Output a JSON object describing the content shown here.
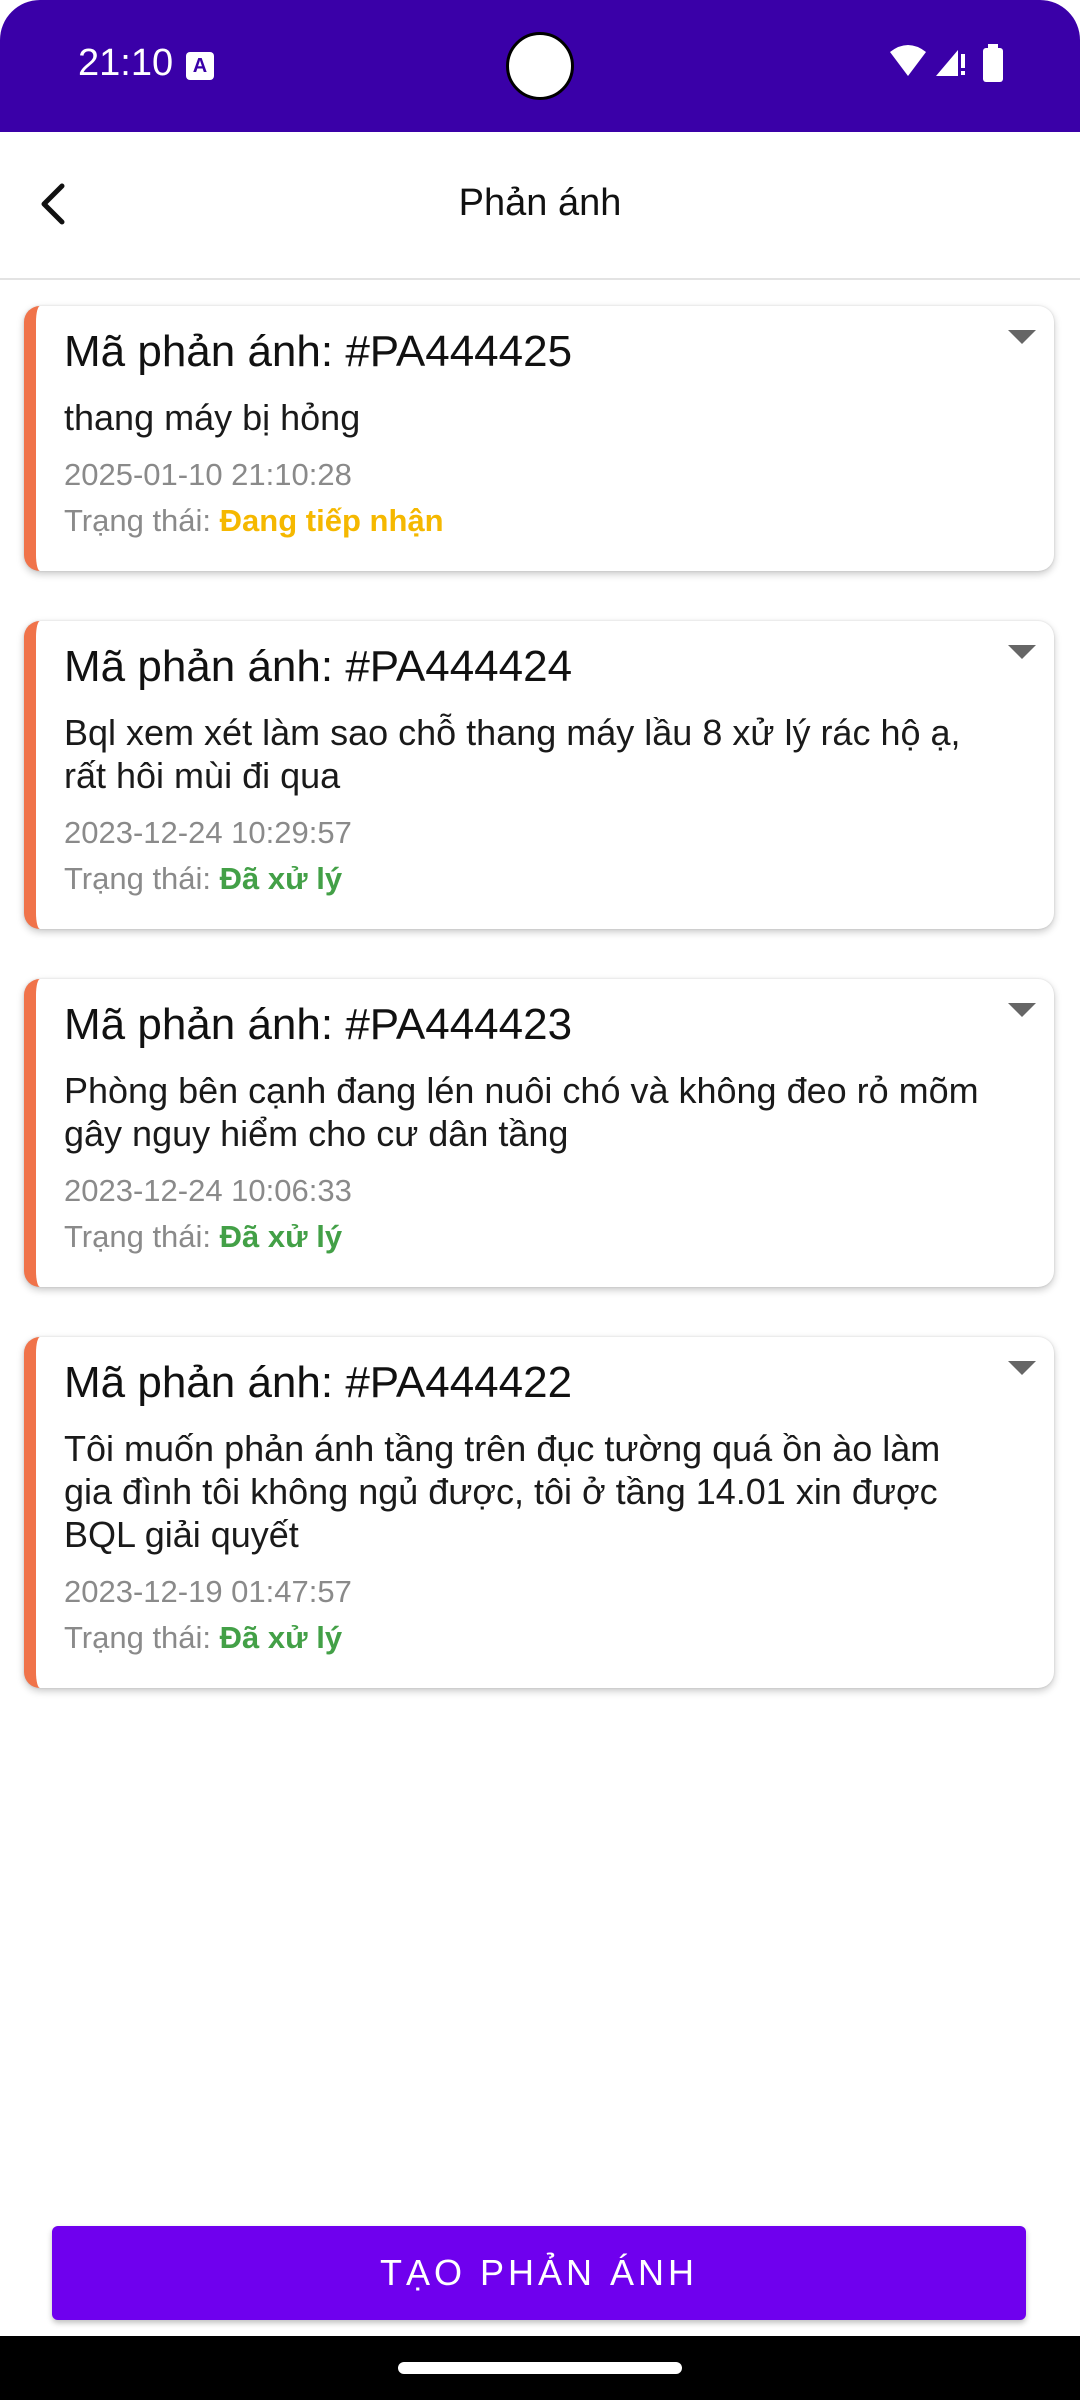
{
  "status_bar": {
    "time": "21:10",
    "background": "#3a00a8",
    "icons": [
      "accessibility-a-icon",
      "wifi-icon",
      "signal-icon",
      "battery-icon"
    ]
  },
  "header": {
    "title": "Phản ánh",
    "back_icon": "chevron-left-icon"
  },
  "colors": {
    "accent_bar": "#f0734a",
    "status_pending": "#f5b800",
    "status_done": "#43a047",
    "button": "#6f00ee"
  },
  "reports": [
    {
      "code": "Mã phản ánh: #PA444425",
      "content": "thang máy bị hỏng",
      "date": "2025-01-10 21:10:28",
      "status_label": "Trạng thái:",
      "status_value": "Đang tiếp nhận",
      "status_color": "#f5b800"
    },
    {
      "code": "Mã phản ánh: #PA444424",
      "content": "Bql xem xét làm sao chỗ thang máy lầu 8 xử lý rác hộ ạ, rất hôi mùi đi qua",
      "date": "2023-12-24 10:29:57",
      "status_label": "Trạng thái:",
      "status_value": "Đã xử lý",
      "status_color": "#43a047"
    },
    {
      "code": "Mã phản ánh: #PA444423",
      "content": "Phòng bên cạnh đang lén nuôi chó và không đeo rỏ mõm gây nguy hiểm cho cư dân tầng",
      "date": "2023-12-24 10:06:33",
      "status_label": "Trạng thái:",
      "status_value": "Đã xử lý",
      "status_color": "#43a047"
    },
    {
      "code": "Mã phản ánh: #PA444422",
      "content": "Tôi muốn phản ánh tầng trên đục tường quá ồn ào làm gia đình tôi không ngủ được, tôi ở tầng 14.01 xin được BQL giải quyết",
      "date": "2023-12-19 01:47:57",
      "status_label": "Trạng thái:",
      "status_value": "Đã xử lý",
      "status_color": "#43a047"
    }
  ],
  "footer": {
    "create_button": "TẠO PHẢN ÁNH"
  }
}
